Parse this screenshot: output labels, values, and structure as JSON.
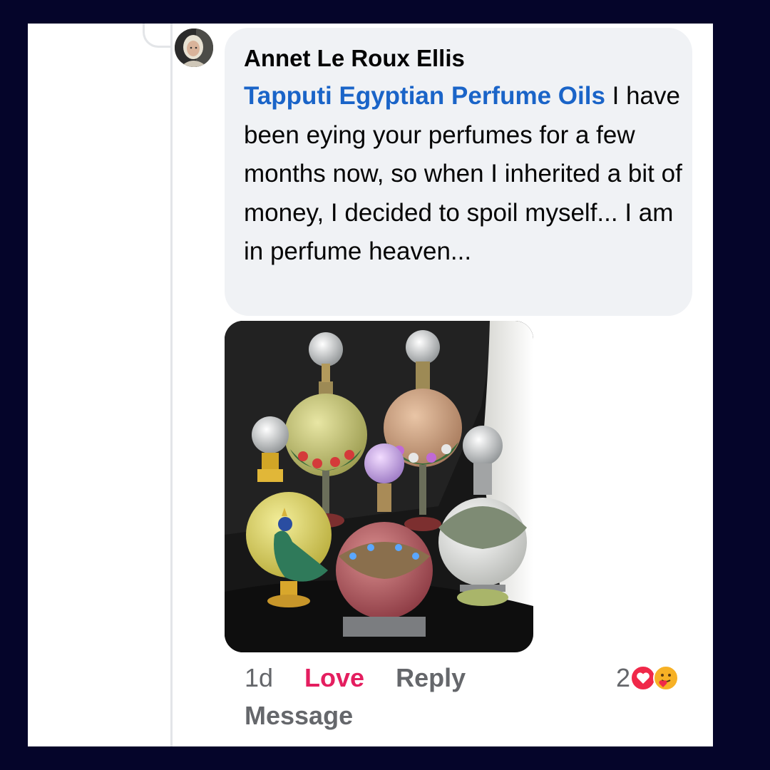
{
  "comment": {
    "author": "Annet Le Roux Ellis",
    "mention": "Tapputi Egyptian Perfume Oils",
    "text": " I have been eying your perfumes for a few months now, so when I inherited a bit of money, I decided to spoil myself... I am in perfume heaven..."
  },
  "actions": {
    "time": "1d",
    "love": "Love",
    "reply": "Reply",
    "message": "Message"
  },
  "reactions": {
    "count": "2",
    "icons": [
      "love-reaction-icon",
      "care-reaction-icon"
    ]
  },
  "colors": {
    "page_background": "#05052a",
    "bubble": "#f0f2f5",
    "mention": "#1a64c8",
    "love": "#e41e5f",
    "muted": "#65676b"
  }
}
